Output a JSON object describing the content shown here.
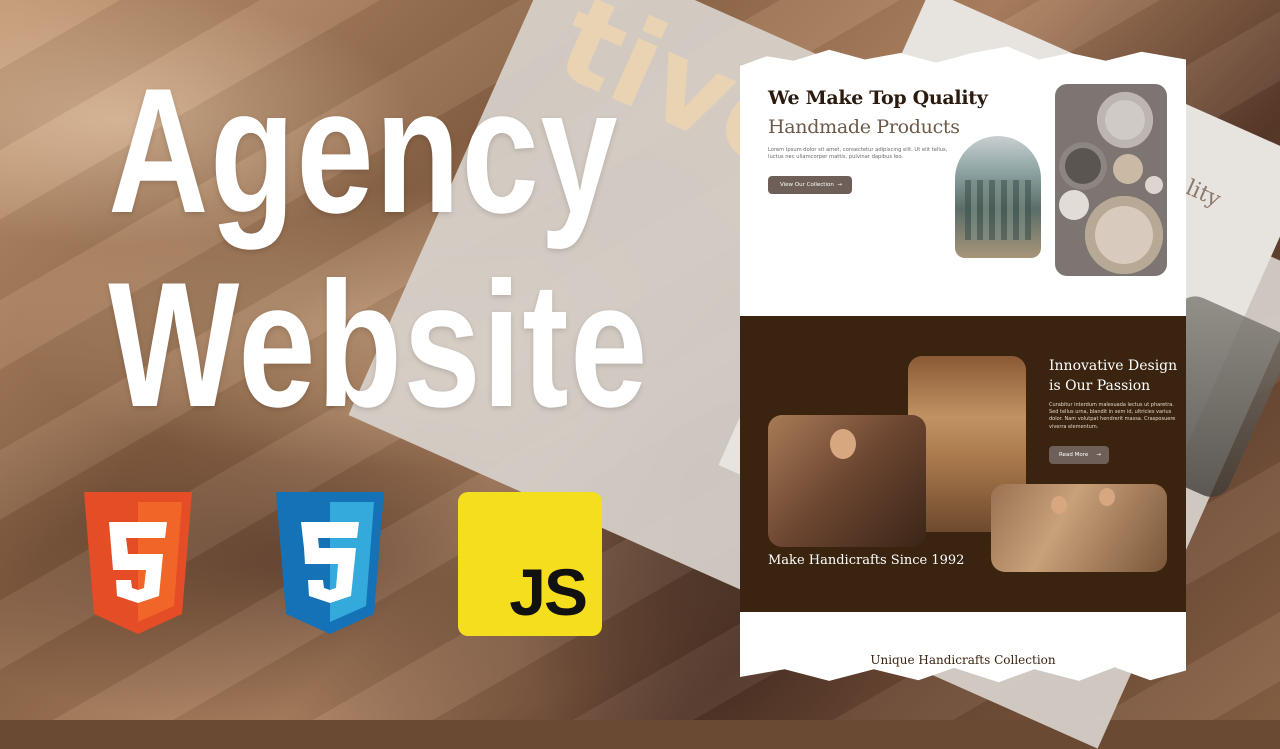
{
  "thumbnail": {
    "title_line1": "Agency",
    "title_line2": "Website",
    "background_word": "tive"
  },
  "tech_logos": [
    {
      "name": "html5-icon",
      "label": "5",
      "color": "#e44d26"
    },
    {
      "name": "css3-icon",
      "label": "3",
      "color": "#1572b6"
    },
    {
      "name": "javascript-icon",
      "label": "JS",
      "color": "#f5de1d"
    }
  ],
  "mockup": {
    "hero": {
      "title": "We Make Top Quality",
      "subtitle": "Handmade Products",
      "description": "Lorem ipsum dolor sit amet, consectetur adipiscing elit. Ut elit tellus, luctus nec ullamcorper mattis, pulvinar dapibus leo.",
      "button_label": "View Our Collection",
      "button_arrow": "→"
    },
    "feature": {
      "title": "Innovative Design is Our Passion",
      "description": "Curabitur interdum malesuada lectus ut pharetra. Sed tellus urna, blandit in sem id, ultricies varius dolor. Nam volutpat hendrerit massa. Crasposuere viverra elementum.",
      "button_label": "Read More",
      "button_arrow": "→",
      "since": "Make Handicrafts Since 1992"
    },
    "collection": {
      "title": "Unique Handicrafts Collection"
    }
  },
  "background_mockup": {
    "text": "ality"
  },
  "colors": {
    "dark_brown": "#3a230f",
    "button_gray": "#6e6058"
  }
}
